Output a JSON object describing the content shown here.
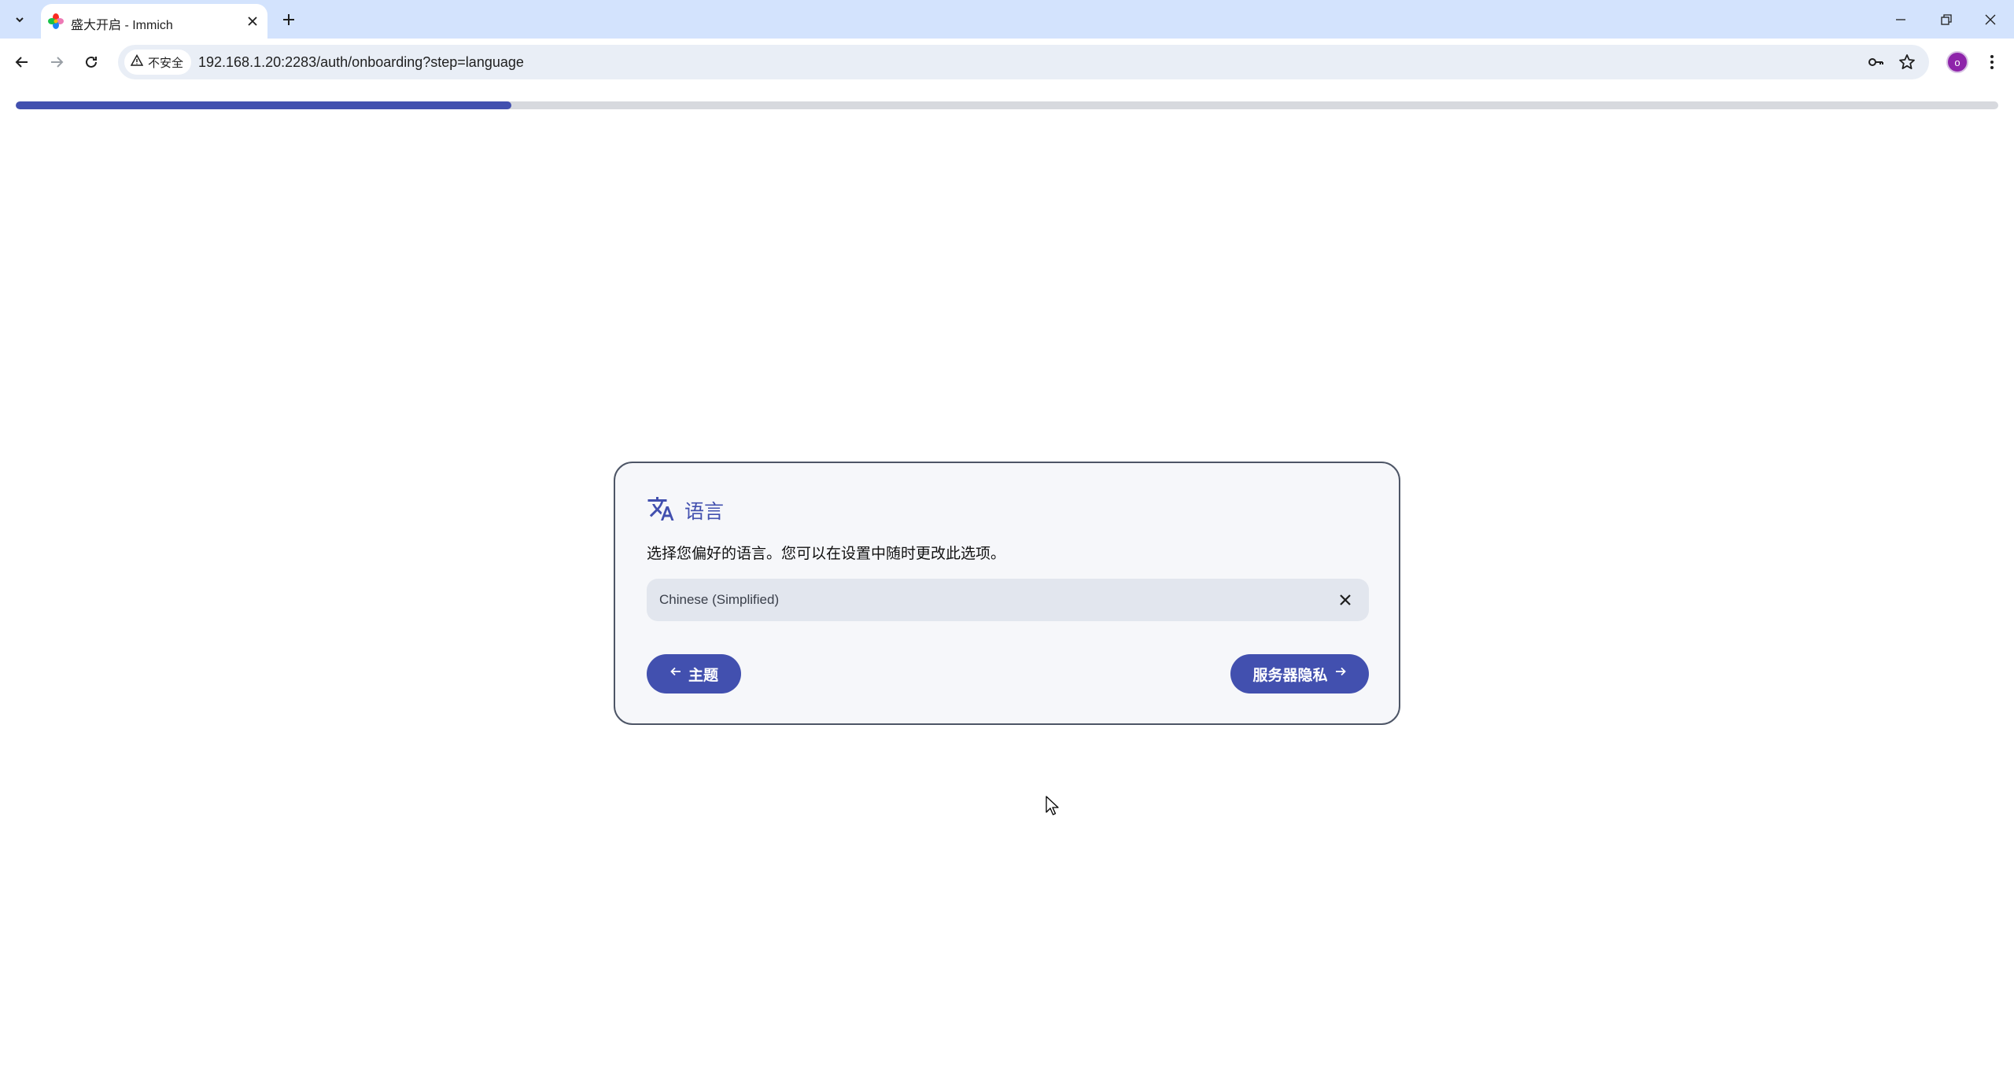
{
  "browser": {
    "tab": {
      "title": "盛大开启 - Immich"
    },
    "address_bar": {
      "security_label": "不安全",
      "url": "192.168.1.20:2283/auth/onboarding?step=language"
    },
    "profile_initial": "o"
  },
  "page": {
    "progress": {
      "value_percent": 25
    },
    "language_card": {
      "title": "语言",
      "description": "选择您偏好的语言。您可以在设置中随时更改此选项。",
      "selected_language": "Chinese (Simplified)",
      "back_button_label": "主题",
      "next_button_label": "服务器隐私"
    }
  },
  "colors": {
    "accent": "#4250af",
    "tabstrip": "#d3e3fd"
  }
}
